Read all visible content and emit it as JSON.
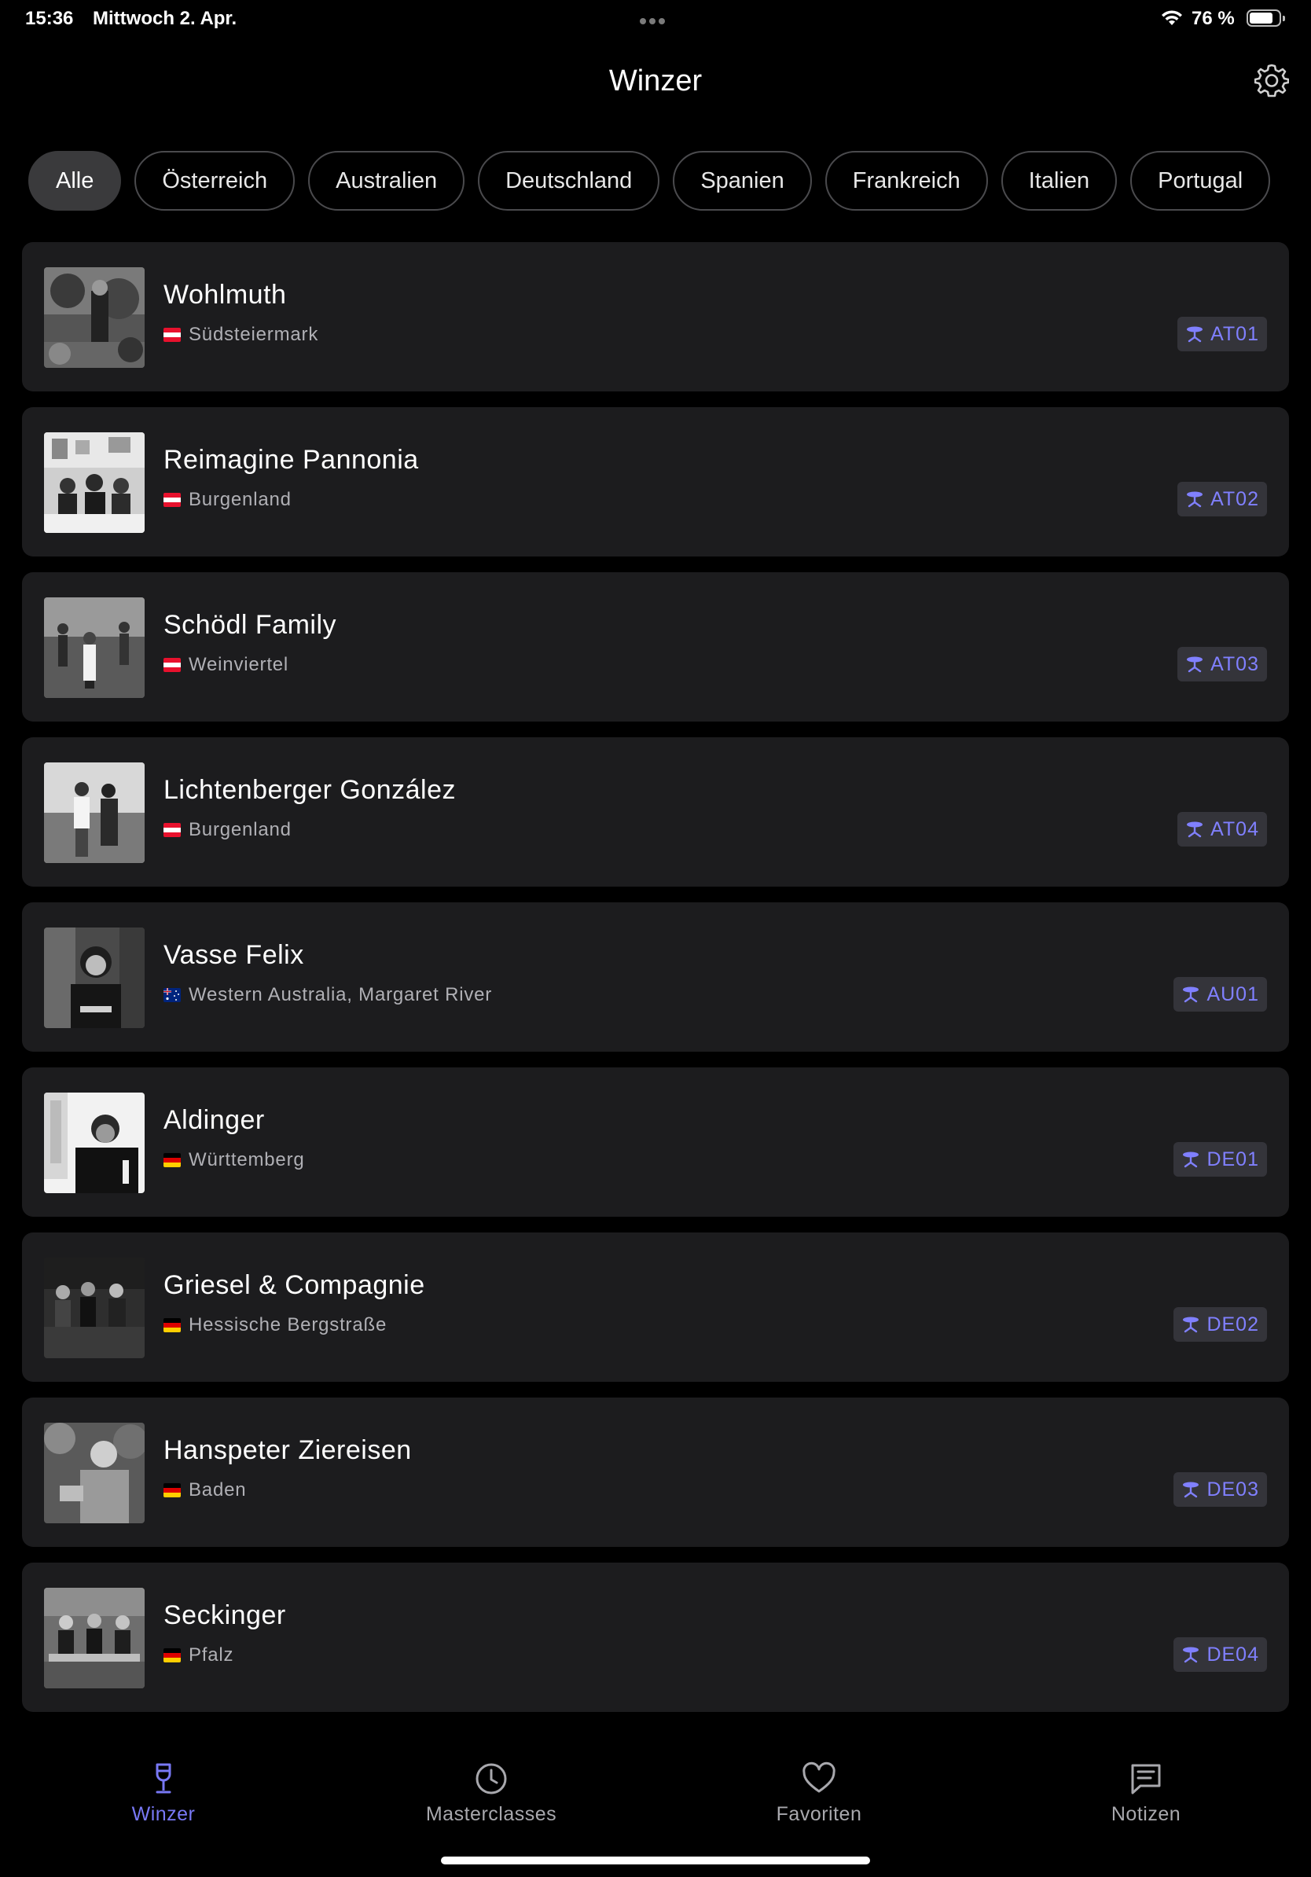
{
  "status": {
    "time": "15:36",
    "date": "Mittwoch 2. Apr.",
    "battery": "76 %",
    "battery_level": 0.76
  },
  "header": {
    "title": "Winzer",
    "settings_icon": "gear-icon"
  },
  "filters": {
    "active": "Alle",
    "items": [
      "Alle",
      "Österreich",
      "Australien",
      "Deutschland",
      "Spanien",
      "Frankreich",
      "Italien",
      "Portugal"
    ]
  },
  "winzer": [
    {
      "name": "Wohlmuth",
      "region": "Südsteiermark",
      "flag": "AT",
      "code": "AT01"
    },
    {
      "name": "Reimagine Pannonia",
      "region": "Burgenland",
      "flag": "AT",
      "code": "AT02"
    },
    {
      "name": "Schödl Family",
      "region": "Weinviertel",
      "flag": "AT",
      "code": "AT03"
    },
    {
      "name": "Lichtenberger González",
      "region": "Burgenland",
      "flag": "AT",
      "code": "AT04"
    },
    {
      "name": "Vasse Felix",
      "region": "Western Australia, Margaret River",
      "flag": "AU",
      "code": "AU01"
    },
    {
      "name": "Aldinger",
      "region": "Württemberg",
      "flag": "DE",
      "code": "DE01"
    },
    {
      "name": "Griesel & Compagnie",
      "region": "Hessische Bergstraße",
      "flag": "DE",
      "code": "DE02"
    },
    {
      "name": "Hanspeter Ziereisen",
      "region": "Baden",
      "flag": "DE",
      "code": "DE03"
    },
    {
      "name": "Seckinger",
      "region": "Pfalz",
      "flag": "DE",
      "code": "DE04"
    }
  ],
  "tabs": [
    {
      "label": "Winzer",
      "icon": "wine-glass-icon",
      "active": true
    },
    {
      "label": "Masterclasses",
      "icon": "clock-icon",
      "active": false
    },
    {
      "label": "Favoriten",
      "icon": "heart-icon",
      "active": false
    },
    {
      "label": "Notizen",
      "icon": "chat-bubble-icon",
      "active": false
    }
  ],
  "colors": {
    "accent": "#7878f5",
    "card": "#1c1c1e",
    "background": "#000000",
    "badge_bg": "#34343a"
  }
}
